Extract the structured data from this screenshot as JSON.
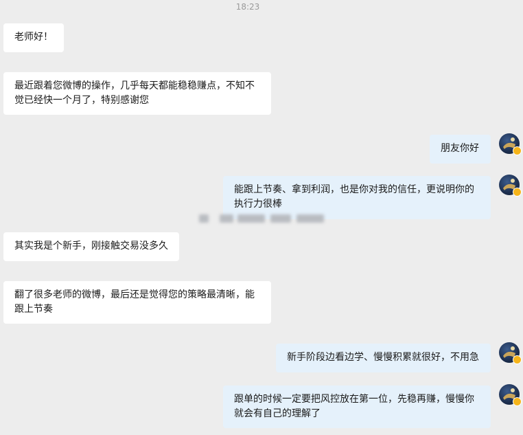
{
  "timestamp": "18:23",
  "messages": [
    {
      "side": "left",
      "text": "老师好！"
    },
    {
      "side": "left",
      "text": "最近跟着您微博的操作，几乎每天都能稳稳赚点，不知不觉已经快一个月了，特别感谢您"
    },
    {
      "side": "right",
      "text": "朋友你好"
    },
    {
      "side": "right",
      "text": "能跟上节奏、拿到利润，也是你对我的信任，更说明你的执行力很棒"
    },
    {
      "side": "left",
      "text": "其实我是个新手，刚接触交易没多久"
    },
    {
      "side": "left",
      "text": "翻了很多老师的微博，最后还是觉得您的策略最清晰，能跟上节奏"
    },
    {
      "side": "right",
      "text": "新手阶段边看边学、慢慢积累就很好，不用急"
    },
    {
      "side": "right",
      "text": "跟单的时候一定要把风控放在第一位，先稳再赚，慢慢你就会有自己的理解了"
    }
  ],
  "colors": {
    "background": "#ededed",
    "left_bubble": "#ffffff",
    "right_bubble": "#e5f1fb",
    "verified_badge": "#f5b41b"
  },
  "icons": {
    "avatar": "user-avatar-icon",
    "badge": "verified-badge-icon"
  }
}
